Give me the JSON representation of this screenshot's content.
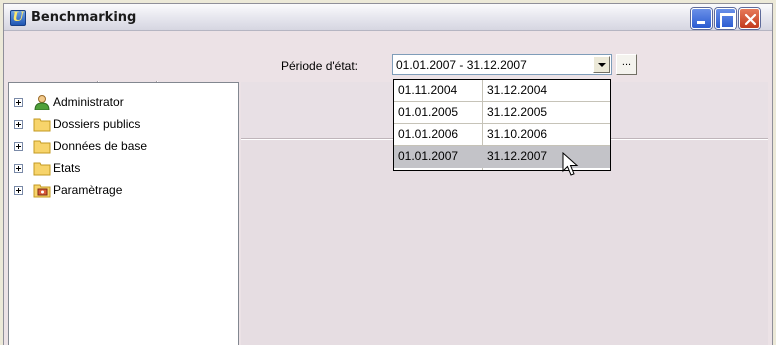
{
  "window": {
    "title": "Benchmarking",
    "app_icon_glyph": "U"
  },
  "toolbar": {
    "tools": [
      "new-doc-icon",
      "print-icon",
      "print-preview-icon",
      "chart-icon",
      "table-icon",
      "list-icon",
      "edit-doc-icon"
    ]
  },
  "period": {
    "label": "Période d'état:",
    "value": "01.01.2007 - 31.12.2007",
    "ellipsis_label": "...",
    "options": [
      {
        "start": "01.11.2004",
        "end": "31.12.2004"
      },
      {
        "start": "01.01.2005",
        "end": "31.12.2005"
      },
      {
        "start": "01.01.2006",
        "end": "31.10.2006"
      },
      {
        "start": "01.01.2007",
        "end": "31.12.2007"
      }
    ],
    "selected_index": 3
  },
  "tree": {
    "items": [
      {
        "label": "Administrator",
        "icon": "user-icon"
      },
      {
        "label": "Dossiers publics",
        "icon": "folder-icon"
      },
      {
        "label": "Données de base",
        "icon": "folder-icon"
      },
      {
        "label": "Etats",
        "icon": "folder-icon"
      },
      {
        "label": "Paramètrage",
        "icon": "settings-icon"
      }
    ]
  },
  "colors": {
    "window_bg": "#ece2e6",
    "selection": "#c3c3c8",
    "close_button": "#c23a1e"
  }
}
